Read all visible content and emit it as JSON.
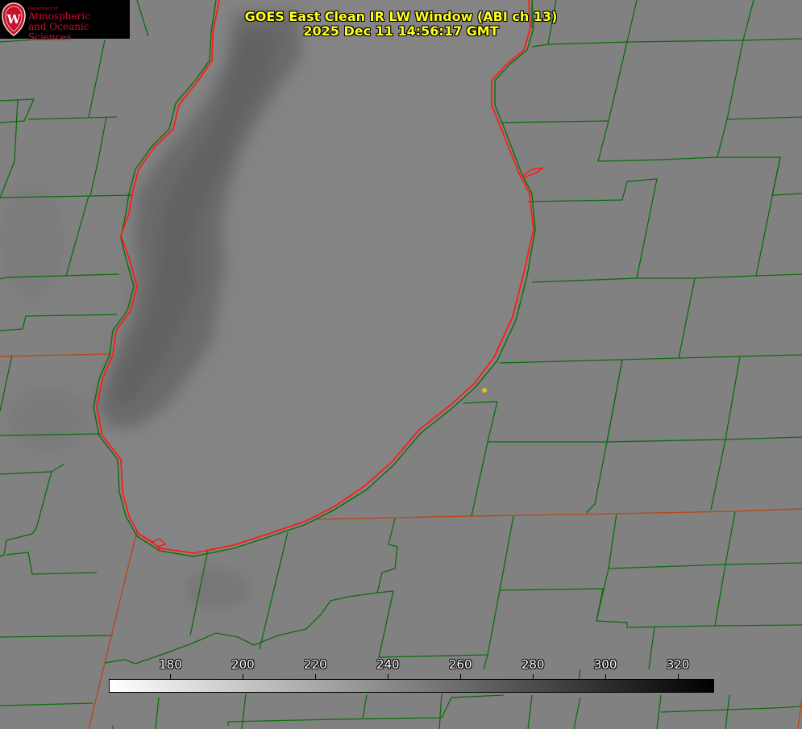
{
  "logo": {
    "dept_text": "Department of",
    "line1": "Atmospheric",
    "line2": "and Oceanic Sciences",
    "seal_letter": "W",
    "colors": {
      "background": "#000000",
      "text": "#c8102e"
    }
  },
  "title": {
    "line1": "GOES East Clean IR LW Window (ABI ch 13)",
    "line2": "2025 Dec 11 14:56:17 GMT",
    "color": "#ffff1e"
  },
  "colorbar": {
    "ticks": [
      {
        "value": 180,
        "label": "180"
      },
      {
        "value": 200,
        "label": "200"
      },
      {
        "value": 220,
        "label": "220"
      },
      {
        "value": 240,
        "label": "240"
      },
      {
        "value": 260,
        "label": "260"
      },
      {
        "value": 280,
        "label": "280"
      },
      {
        "value": 300,
        "label": "300"
      },
      {
        "value": 320,
        "label": "320"
      }
    ],
    "range": [
      163,
      330
    ],
    "low_color": "#ffffff",
    "high_color": "#000000"
  },
  "map": {
    "colors": {
      "background": "#818181",
      "cloud": "#6d6d6d",
      "county_lines": "#0b6e0b",
      "state_lines": "#b54a1a",
      "shoreline": "#ff1a1a",
      "marker": "#d9c21a"
    },
    "marker_icon": "location-dot-icon"
  }
}
